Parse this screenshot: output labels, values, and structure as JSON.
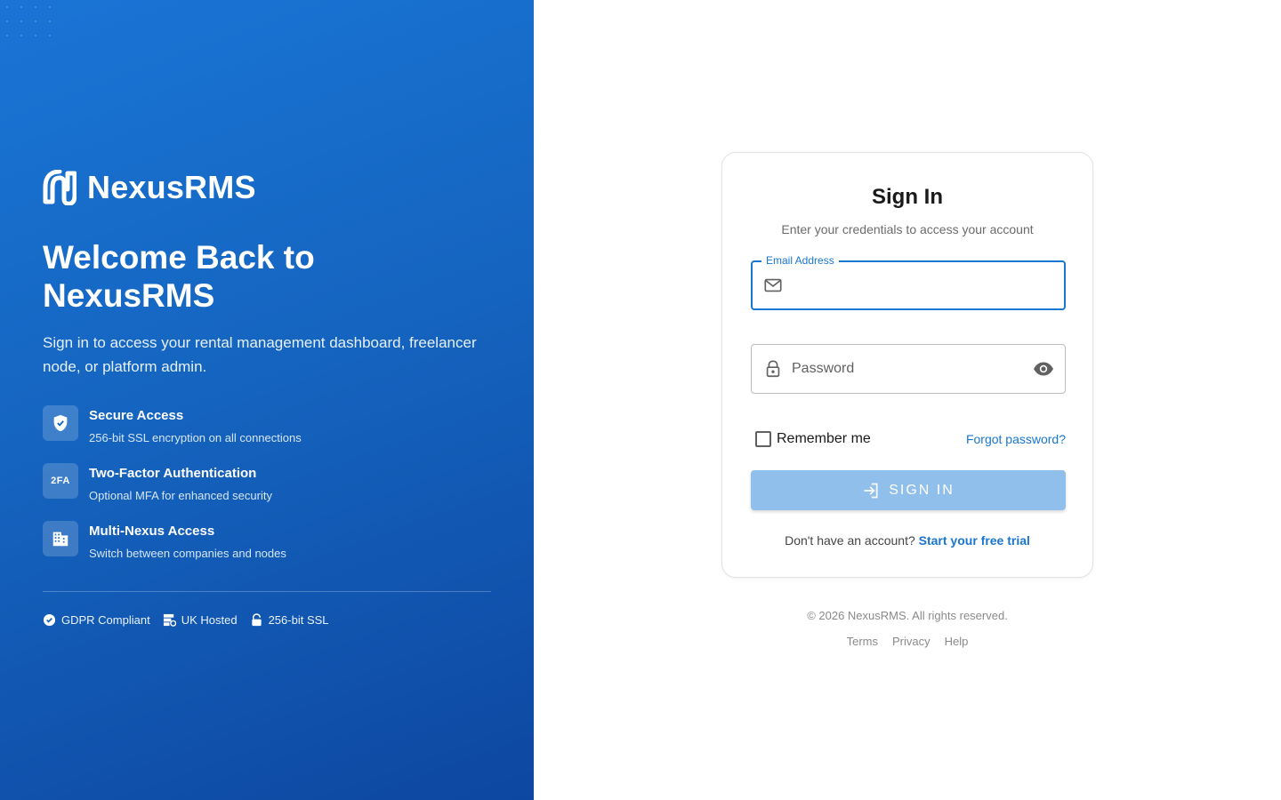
{
  "brand": {
    "name": "NexusRMS",
    "logo_icon": "nexus-n-logo"
  },
  "hero": {
    "title": "Welcome Back to NexusRMS",
    "subtitle": "Sign in to access your rental management dashboard, freelancer node, or platform admin.",
    "features": [
      {
        "icon": "shield-check-icon",
        "title": "Secure Access",
        "desc": "256-bit SSL encryption on all connections"
      },
      {
        "icon": "2fa-icon",
        "icon_text": "2FA",
        "title": "Two-Factor Authentication",
        "desc": "Optional MFA for enhanced security"
      },
      {
        "icon": "building-icon",
        "title": "Multi-Nexus Access",
        "desc": "Switch between companies and nodes"
      }
    ],
    "badges": [
      {
        "icon": "verified-icon",
        "label": "GDPR Compliant"
      },
      {
        "icon": "server-icon",
        "label": "UK Hosted"
      },
      {
        "icon": "lock-icon",
        "label": "256-bit SSL"
      }
    ]
  },
  "form": {
    "title": "Sign In",
    "subtitle": "Enter your credentials to access your account",
    "email": {
      "label": "Email Address",
      "value": "",
      "placeholder": ""
    },
    "password": {
      "placeholder": "Password",
      "value": ""
    },
    "remember_label": "Remember me",
    "forgot_label": "Forgot password?",
    "signin_label": "SIGN IN",
    "signup_prompt": "Don't have an account?",
    "signup_link": "Start your free trial"
  },
  "footer": {
    "copyright": "© 2026 NexusRMS. All rights reserved.",
    "links": [
      "Terms",
      "Privacy",
      "Help"
    ]
  },
  "colors": {
    "primary": "#1976d2",
    "hero_start": "#1a75d6",
    "hero_end": "#0d47a1",
    "button_disabled": "#90bfec"
  }
}
